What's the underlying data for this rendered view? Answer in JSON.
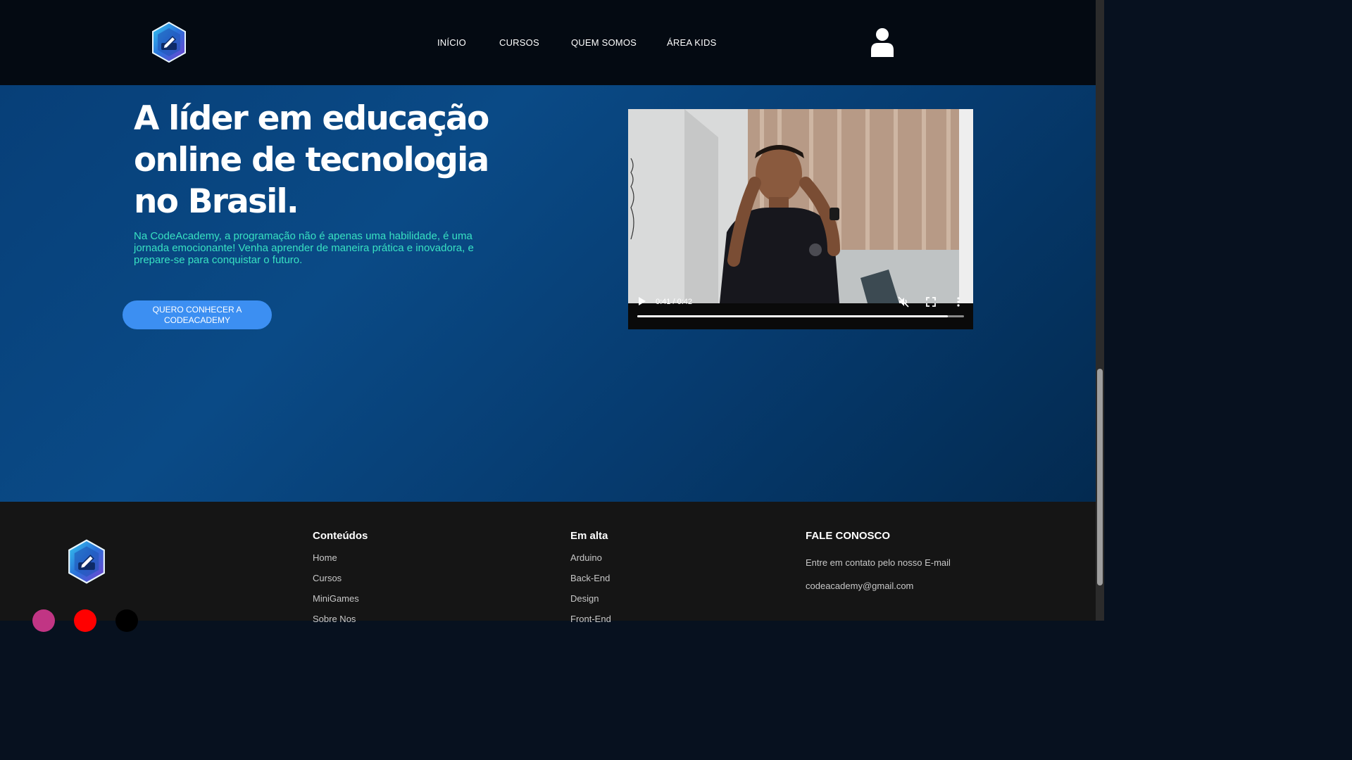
{
  "header": {
    "logo_icon": "hexagon-pencil-logo-icon",
    "nav": [
      {
        "label": "INÍCIO"
      },
      {
        "label": "CURSOS"
      },
      {
        "label": "QUEM SOMOS"
      },
      {
        "label": "ÁREA KIDS"
      }
    ],
    "user_icon": "user-icon"
  },
  "hero": {
    "title": "A líder em educação online de tecnologia no Brasil.",
    "subtitle": "Na CodeAcademy, a programação não é apenas uma habilidade, é uma jornada emocionante! Venha aprender de maneira prática e inovadora, e prepare-se para conquistar o futuro.",
    "cta_label": "QUERO CONHECER A CODEACADEMY"
  },
  "video": {
    "time": "0:41 / 0:42",
    "progress": 0.95,
    "muted": true
  },
  "footer": {
    "columns": [
      {
        "title": "Conteúdos",
        "links": [
          "Home",
          "Cursos",
          "MiniGames",
          "Sobre Nos"
        ]
      },
      {
        "title": "Em alta",
        "links": [
          "Arduino",
          "Back-End",
          "Design",
          "Front-End"
        ]
      },
      {
        "title": "FALE CONOSCO",
        "lines": [
          "Entre em contato pelo nosso E-mail",
          "codeacademy@gmail.com"
        ]
      }
    ],
    "social": [
      {
        "icon": "instagram-icon",
        "color": "#c13584"
      },
      {
        "icon": "youtube-icon",
        "color": "#ff0000"
      },
      {
        "icon": "tiktok-icon",
        "color": "#000000"
      }
    ]
  },
  "colors": {
    "accent_teal": "#38e1c2",
    "cta_blue": "#3c8ff2",
    "header_bg": "#040a12",
    "hero_bg": "#0a4a86",
    "footer_bg": "#151515"
  }
}
